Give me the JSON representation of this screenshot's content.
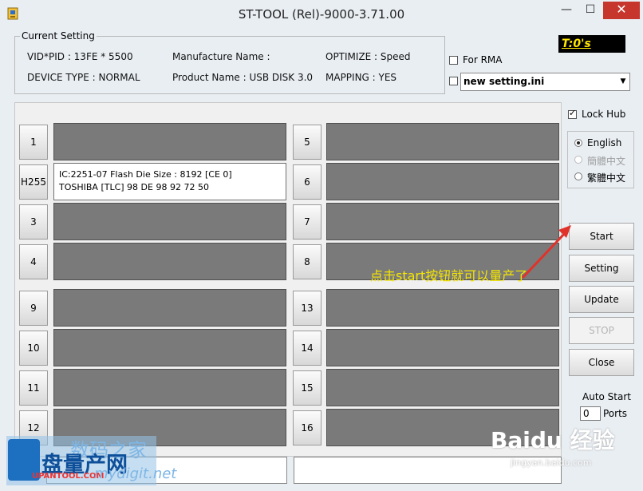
{
  "window": {
    "title": "ST-TOOL (Rel)-9000-3.71.00"
  },
  "current_setting": {
    "legend": "Current Setting",
    "vid_pid": "VID*PID : 13FE * 5500",
    "manufacture_name": "Manufacture Name :",
    "optimize": "OPTIMIZE : Speed",
    "device_type": "DEVICE TYPE : NORMAL",
    "product_name": "Product Name : USB DISK 3.0",
    "mapping": "MAPPING : YES"
  },
  "timer": "T:0's",
  "for_rma": {
    "label": "For RMA",
    "checked": false
  },
  "setting_file": {
    "value": "new setting.ini",
    "checked": false
  },
  "lock_hub": {
    "label": "Lock Hub",
    "checked": true
  },
  "language": {
    "options": [
      "English",
      "簡體中文",
      "繁體中文"
    ],
    "selected": "English"
  },
  "buttons": {
    "start": "Start",
    "setting": "Setting",
    "update": "Update",
    "stop": "STOP",
    "close": "Close"
  },
  "auto_start": {
    "label": "Auto Start",
    "value": "0",
    "unit": "Ports"
  },
  "ports": {
    "left": [
      {
        "label": "1",
        "line1": "",
        "line2": ""
      },
      {
        "label": "H255",
        "line1": "IC:2251-07 Flash Die Size : 8192 [CE 0]",
        "line2": "TOSHIBA [TLC] 98 DE 98 92 72 50"
      },
      {
        "label": "3",
        "line1": "",
        "line2": ""
      },
      {
        "label": "4",
        "line1": "",
        "line2": ""
      },
      {
        "label": "9",
        "line1": "",
        "line2": ""
      },
      {
        "label": "10",
        "line1": "",
        "line2": ""
      },
      {
        "label": "11",
        "line1": "",
        "line2": ""
      },
      {
        "label": "12",
        "line1": "",
        "line2": ""
      }
    ],
    "right": [
      {
        "label": "5"
      },
      {
        "label": "6"
      },
      {
        "label": "7"
      },
      {
        "label": "8"
      },
      {
        "label": "13"
      },
      {
        "label": "14"
      },
      {
        "label": "15"
      },
      {
        "label": "16"
      }
    ]
  },
  "annotation": "点击start按钮就可以量产了",
  "watermarks": {
    "cn_top": "数码之家",
    "cn_main": "盘量产网",
    "url_small": "UPANTOOL.COM",
    "url_italic": "mydigit.net",
    "baidu": "Baidu 经验",
    "baidu_sub": "jingyan.baidu.com"
  },
  "colors": {
    "close_button": "#c7362c",
    "timer_text": "#ffe600",
    "annotation": "#f5e600",
    "active_port": "#ffffff",
    "idle_port": "#7a7a7a"
  }
}
